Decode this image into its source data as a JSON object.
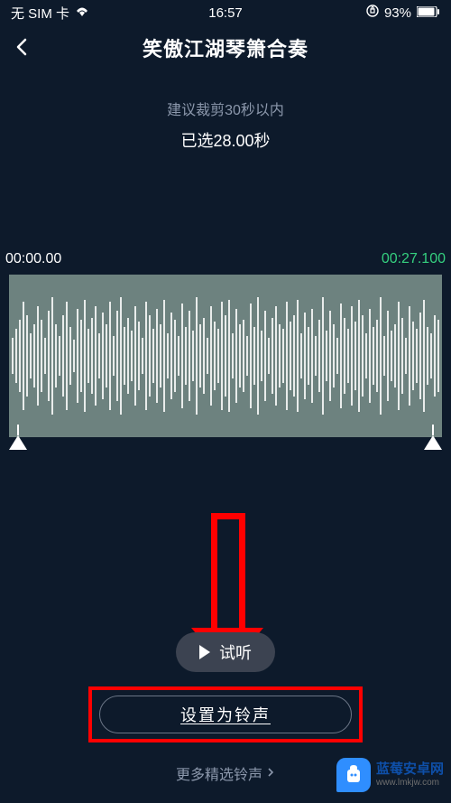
{
  "status": {
    "sim": "无 SIM 卡",
    "time": "16:57",
    "battery_pct": "93%"
  },
  "nav": {
    "title": "笑傲江湖琴箫合奏"
  },
  "hint": {
    "tip": "建议裁剪30秒以内",
    "selected": "已选28.00秒"
  },
  "waveform": {
    "time_start": "00:00.00",
    "time_end": "00:27.100"
  },
  "buttons": {
    "preview": "试听",
    "set_ringtone": "设置为铃声"
  },
  "more": {
    "label": "更多精选铃声"
  },
  "watermark": {
    "name": "蓝莓安卓网",
    "url": "www.lmkjw.com"
  }
}
